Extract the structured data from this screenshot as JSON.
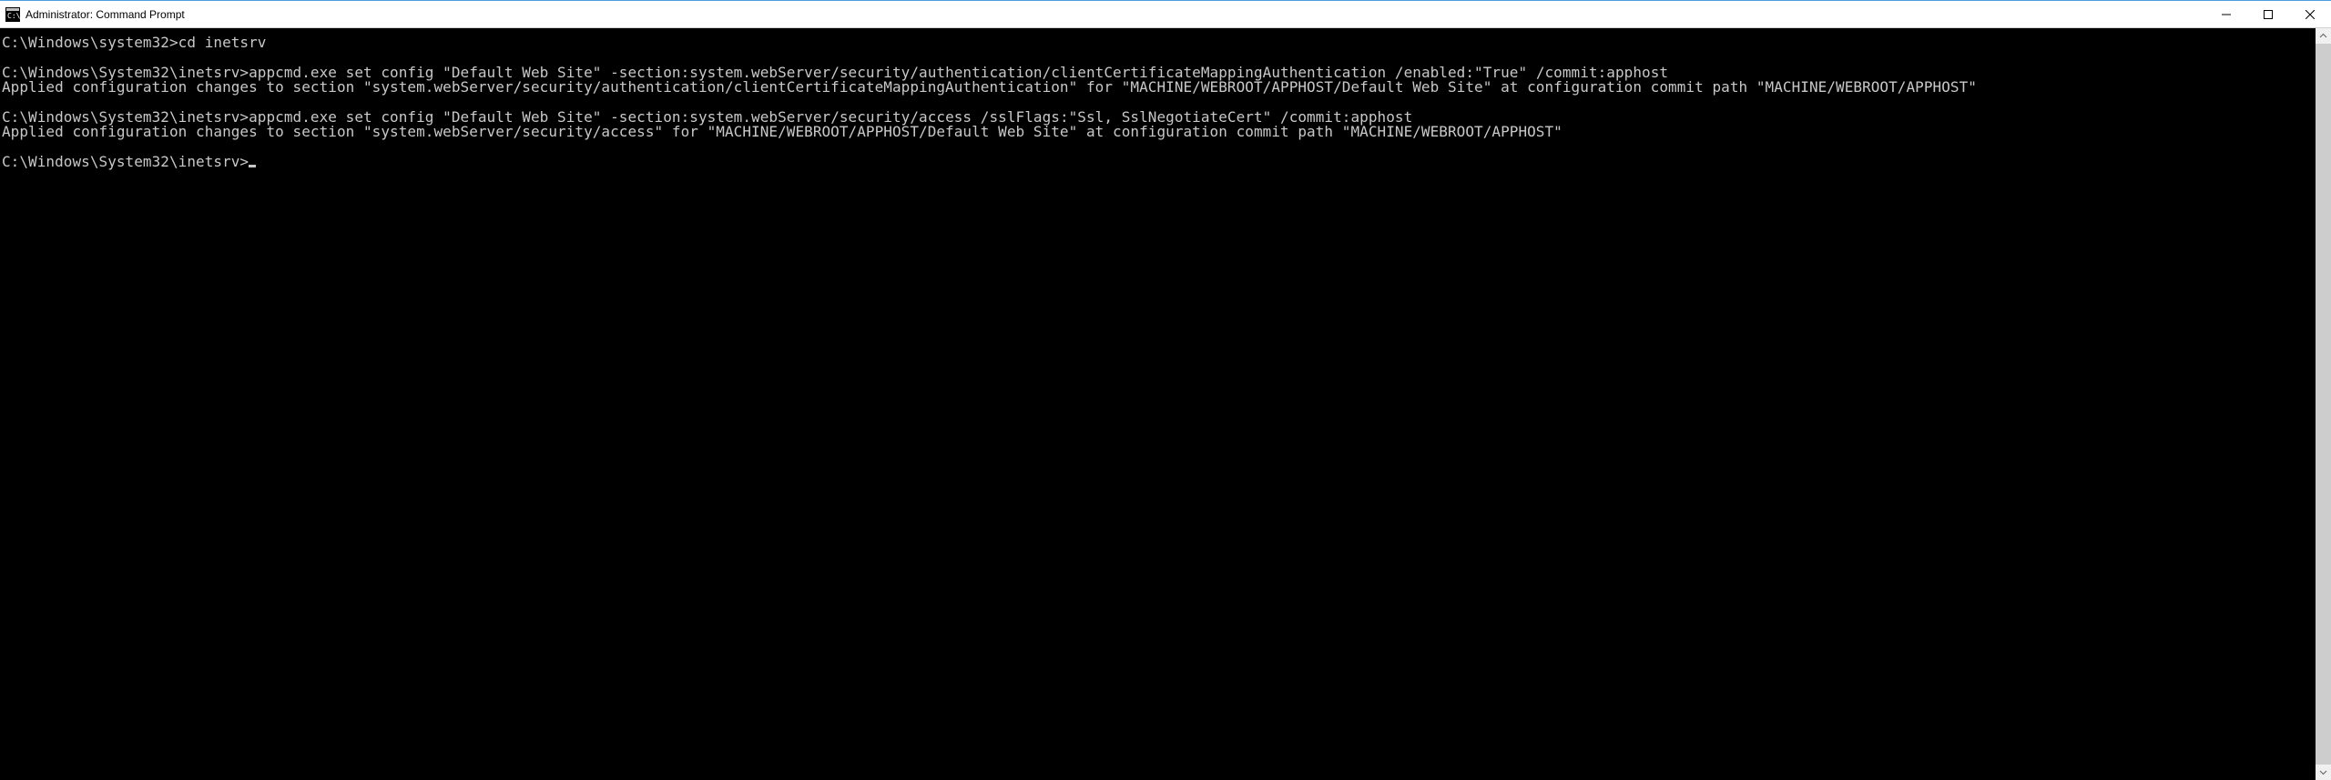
{
  "window": {
    "title": "Administrator: Command Prompt"
  },
  "terminal": {
    "lines": [
      {
        "type": "cmd",
        "prompt": "C:\\Windows\\system32>",
        "input": "cd inetsrv"
      },
      {
        "type": "blank"
      },
      {
        "type": "cmd",
        "prompt": "C:\\Windows\\System32\\inetsrv>",
        "input": "appcmd.exe set config \"Default Web Site\" -section:system.webServer/security/authentication/clientCertificateMappingAuthentication /enabled:\"True\" /commit:apphost"
      },
      {
        "type": "out",
        "text": "Applied configuration changes to section \"system.webServer/security/authentication/clientCertificateMappingAuthentication\" for \"MACHINE/WEBROOT/APPHOST/Default Web Site\" at configuration commit path \"MACHINE/WEBROOT/APPHOST\""
      },
      {
        "type": "blank"
      },
      {
        "type": "cmd",
        "prompt": "C:\\Windows\\System32\\inetsrv>",
        "input": "appcmd.exe set config \"Default Web Site\" -section:system.webServer/security/access /sslFlags:\"Ssl, SslNegotiateCert\" /commit:apphost"
      },
      {
        "type": "out",
        "text": "Applied configuration changes to section \"system.webServer/security/access\" for \"MACHINE/WEBROOT/APPHOST/Default Web Site\" at configuration commit path \"MACHINE/WEBROOT/APPHOST\""
      },
      {
        "type": "blank"
      },
      {
        "type": "prompt",
        "prompt": "C:\\Windows\\System32\\inetsrv>"
      }
    ]
  },
  "colors": {
    "console_bg": "#000000",
    "console_fg": "#c8c8c8",
    "titlebar_bg": "#ffffff",
    "accent_border": "#4ca0e0"
  }
}
